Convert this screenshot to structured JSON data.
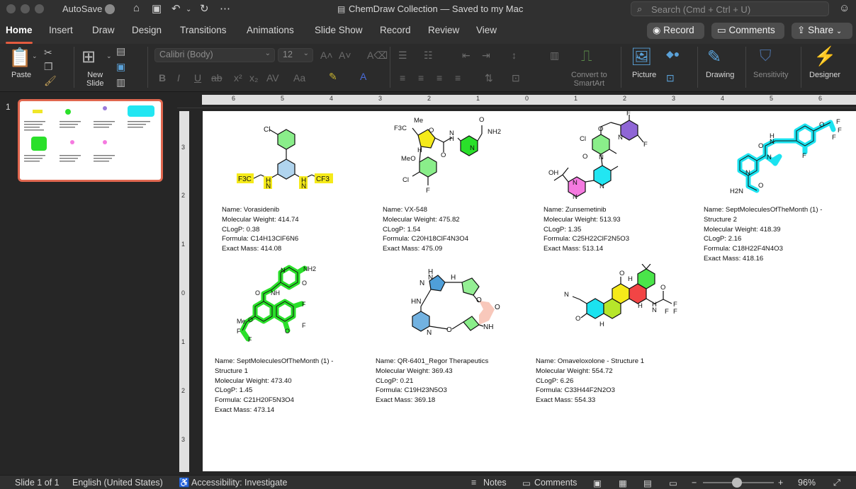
{
  "titlebar": {
    "autosave_label": "AutoSave",
    "document_title": "ChemDraw Collection — Saved to my Mac",
    "search_placeholder": "Search (Cmd + Ctrl + U)"
  },
  "menu": {
    "tabs": [
      "Home",
      "Insert",
      "Draw",
      "Design",
      "Transitions",
      "Animations",
      "Slide Show",
      "Record",
      "Review",
      "View"
    ],
    "active_tab": "Home",
    "record_button": "Record",
    "comments_button": "Comments",
    "share_button": "Share"
  },
  "ribbon": {
    "paste": "Paste",
    "new_slide_line1": "New",
    "new_slide_line2": "Slide",
    "font_family": "Calibri (Body)",
    "font_size": "12",
    "convert_line1": "Convert to",
    "convert_line2": "SmartArt",
    "picture": "Picture",
    "drawing": "Drawing",
    "sensitivity": "Sensitivity",
    "designer": "Designer"
  },
  "thumbnails": {
    "slide_number": "1"
  },
  "ruler": {
    "h_ticks": [
      "6",
      "5",
      "4",
      "3",
      "2",
      "1",
      "0",
      "1",
      "2",
      "3",
      "4",
      "5",
      "6"
    ],
    "v_ticks": [
      "3",
      "2",
      "1",
      "0",
      "1",
      "2",
      "3"
    ]
  },
  "slide": {
    "molecules": [
      {
        "line1": "Name: Vorasidenib",
        "line2": "Molecular Weight: 414.74",
        "line3": "CLogP: 0.38",
        "line4": "Formula: C14H13ClF6N6",
        "line5": "Exact Mass: 414.08"
      },
      {
        "line1": "Name: VX-548",
        "line2": "Molecular Weight: 475.82",
        "line3": "CLogP: 1.54",
        "line4": "Formula: C20H18ClF4N3O4",
        "line5": "Exact Mass: 475.09"
      },
      {
        "line1": "Name: Zunsemetinib",
        "line2": "Molecular Weight: 513.93",
        "line3": "CLogP: 1.35",
        "line4": "Formula: C25H22ClF2N5O3",
        "line5": "Exact Mass: 513.14"
      },
      {
        "line1": "Name: SeptMoleculesOfTheMonth (1) -",
        "line2": "Structure 2",
        "line3": "Molecular Weight: 418.39",
        "line4": "CLogP: 2.16",
        "line5": "Formula: C18H22F4N4O3",
        "line6": "Exact Mass: 418.16"
      },
      {
        "line1": "Name: SeptMoleculesOfTheMonth (1) -",
        "line2": "Structure 1",
        "line3": "Molecular Weight: 473.40",
        "line4": "CLogP: 1.45",
        "line5": "Formula: C21H20F5N3O4",
        "line6": "Exact Mass: 473.14"
      },
      {
        "line1": "Name: QR-6401_Regor Therapeutics",
        "line2": "Molecular Weight: 369.43",
        "line3": "CLogP: 0.21",
        "line4": "Formula: C19H23N5O3",
        "line5": "Exact Mass: 369.18"
      },
      {
        "line1": "Name: Omaveloxolone - Structure 1",
        "line2": "Molecular Weight: 554.72",
        "line3": "CLogP: 6.26",
        "line4": "Formula: C33H44F2N2O3",
        "line5": "Exact Mass: 554.33"
      }
    ],
    "atoms": {
      "cl": "Cl",
      "f3c": "F3C",
      "cf3": "CF3",
      "h": "H",
      "n": "N",
      "nh2": "NH2",
      "o": "O",
      "f": "F",
      "me": "Me",
      "meo": "MeO",
      "oh": "OH",
      "h2n": "H2N",
      "hn": "HN",
      "nh": "NH",
      "h_stereo": "H"
    }
  },
  "statusbar": {
    "slide_indicator": "Slide 1 of 1",
    "language": "English (United States)",
    "accessibility": "Accessibility: Investigate",
    "notes": "Notes",
    "comments": "Comments",
    "zoom_minus": "−",
    "zoom_plus": "+",
    "zoom": "96%"
  },
  "colors": {
    "accent": "#e35b3f",
    "yellow_highlight": "#f5ea1a",
    "green_highlight": "#2ae02a",
    "cyan_highlight": "#1be3f0",
    "blue_highlight": "#4f9fd9",
    "purple_highlight": "#8f66d6",
    "pink_highlight": "#f57ae0",
    "red_highlight": "#f24545",
    "salmon_highlight": "#f7c2b4"
  }
}
